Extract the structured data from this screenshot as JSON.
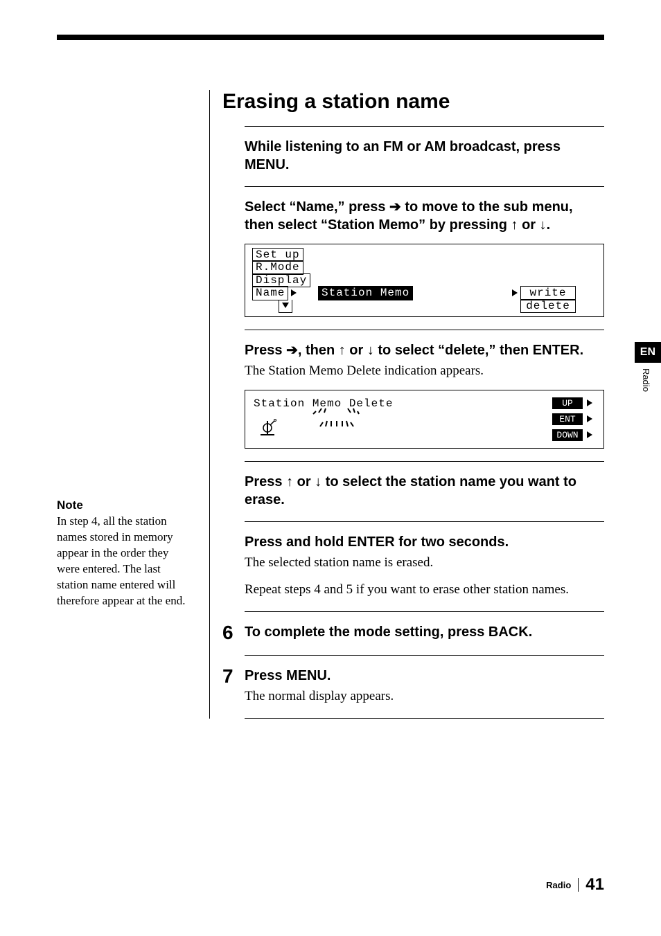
{
  "section_title": "Erasing a station name",
  "note": {
    "heading": "Note",
    "body": "In step 4, all the station names stored in memory appear in the order they were entered. The last station name entered will therefore appear at the end."
  },
  "steps": [
    {
      "head_pre": "While listening to an FM or AM broadcast, press MENU."
    },
    {
      "head_pre": "Select “Name,” press ",
      "head_arrow1": "➔",
      "head_mid": " to move to the sub menu, then select “Station Memo” by pressing ",
      "head_arrow2": "↑",
      "head_or": " or ",
      "head_arrow3": "↓",
      "head_post": ".",
      "lcd": {
        "l1": "Set up",
        "l2": "R.Mode",
        "l3": "Display",
        "l4c1": "Name",
        "l4c2": "Station Memo",
        "l4c3": "write",
        "l5c3": "delete"
      }
    },
    {
      "head_pre": "Press ",
      "head_arrow1": "➔",
      "head_mid": ", then ",
      "head_arrow2": "↑",
      "head_or": " or ",
      "head_arrow3": "↓",
      "head_post": " to select “delete,” then ENTER.",
      "body": "The Station Memo Delete indication appears.",
      "lcd2": {
        "title": "Station Memo Delete",
        "btn_up": "UP",
        "btn_ent": "ENT",
        "btn_down": "DOWN"
      }
    },
    {
      "head_pre": "Press ",
      "head_arrow2": "↑",
      "head_or": " or ",
      "head_arrow3": "↓",
      "head_post": " to select the station name you want to erase."
    },
    {
      "head_pre": "Press and hold ENTER for two seconds.",
      "body": "The selected station name is erased.",
      "body2": "Repeat steps 4 and 5 if you want to erase other station names."
    },
    {
      "num": "6",
      "head_pre": "To complete the mode setting, press BACK."
    },
    {
      "num": "7",
      "head_pre": "Press MENU.",
      "body": "The normal display appears."
    }
  ],
  "side": {
    "lang": "EN",
    "section": "Radio"
  },
  "footer": {
    "section": "Radio",
    "page": "41"
  }
}
